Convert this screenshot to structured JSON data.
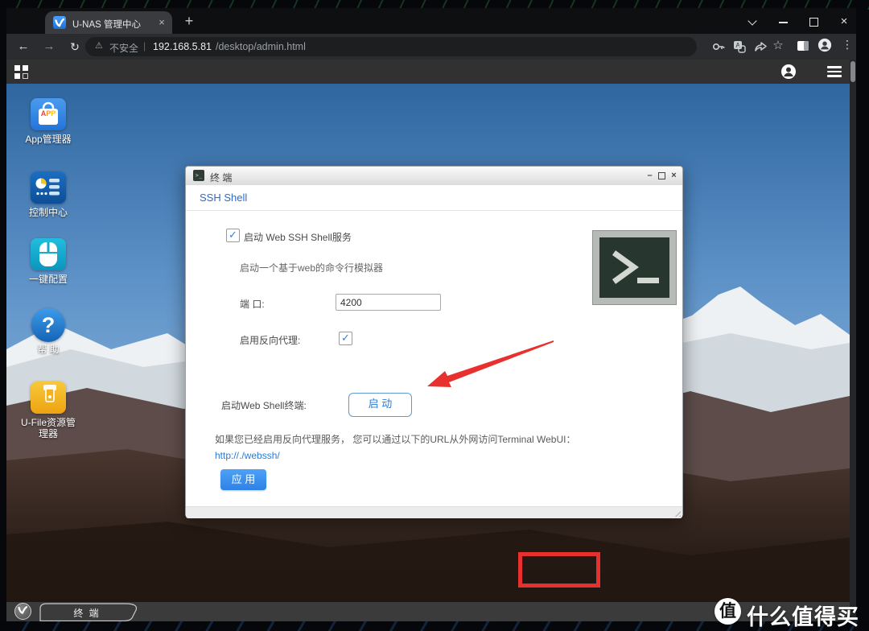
{
  "browser": {
    "tab_title": "U-NAS 管理中心",
    "tab_close": "×",
    "new_tab": "+",
    "window_close": "×",
    "security_label": "不安全",
    "url_divider": "|",
    "url_host": "192.168.5.81",
    "url_path": "/desktop/admin.html"
  },
  "icons": {
    "back": "←",
    "forward": "→",
    "reload": "↻",
    "warning": "⚠",
    "star": "☆",
    "more": "⋮",
    "terminal_prompt": ">_",
    "check": "✓"
  },
  "desktop_icons": [
    {
      "label": "App管理器",
      "badge_letters": [
        "A",
        "P",
        "P"
      ]
    },
    {
      "label": "控制中心"
    },
    {
      "label": "一键配置"
    },
    {
      "label": "帮 助",
      "glyph": "?"
    },
    {
      "label": "U-File资源管理器"
    }
  ],
  "dialog": {
    "title": "终 端",
    "minimize": "–",
    "close": "×",
    "tab_label": "SSH Shell",
    "enable_label": "启动 Web SSH Shell服务",
    "description": "启动一个基于web的命令行模拟器",
    "port_label": "端 口:",
    "port_value": "4200",
    "reverse_proxy_label": "启用反向代理:",
    "web_shell_label": "启动Web Shell终端:",
    "start_button": "启 动",
    "hint": "如果您已经启用反向代理服务， 您可以通过以下的URL从外网访问Terminal WebUI：",
    "link": "http://./webssh/",
    "apply_button": "应 用"
  },
  "taskbar": {
    "window_label": "终 端"
  },
  "watermark": {
    "badge": "值",
    "text": "什么值得买"
  },
  "colors": {
    "accent_blue": "#2f82e6",
    "link_blue": "#2b7bd4",
    "annotation_red": "#e8312e",
    "terminal_green": "#273730",
    "sky_blue": "#4178b4"
  }
}
